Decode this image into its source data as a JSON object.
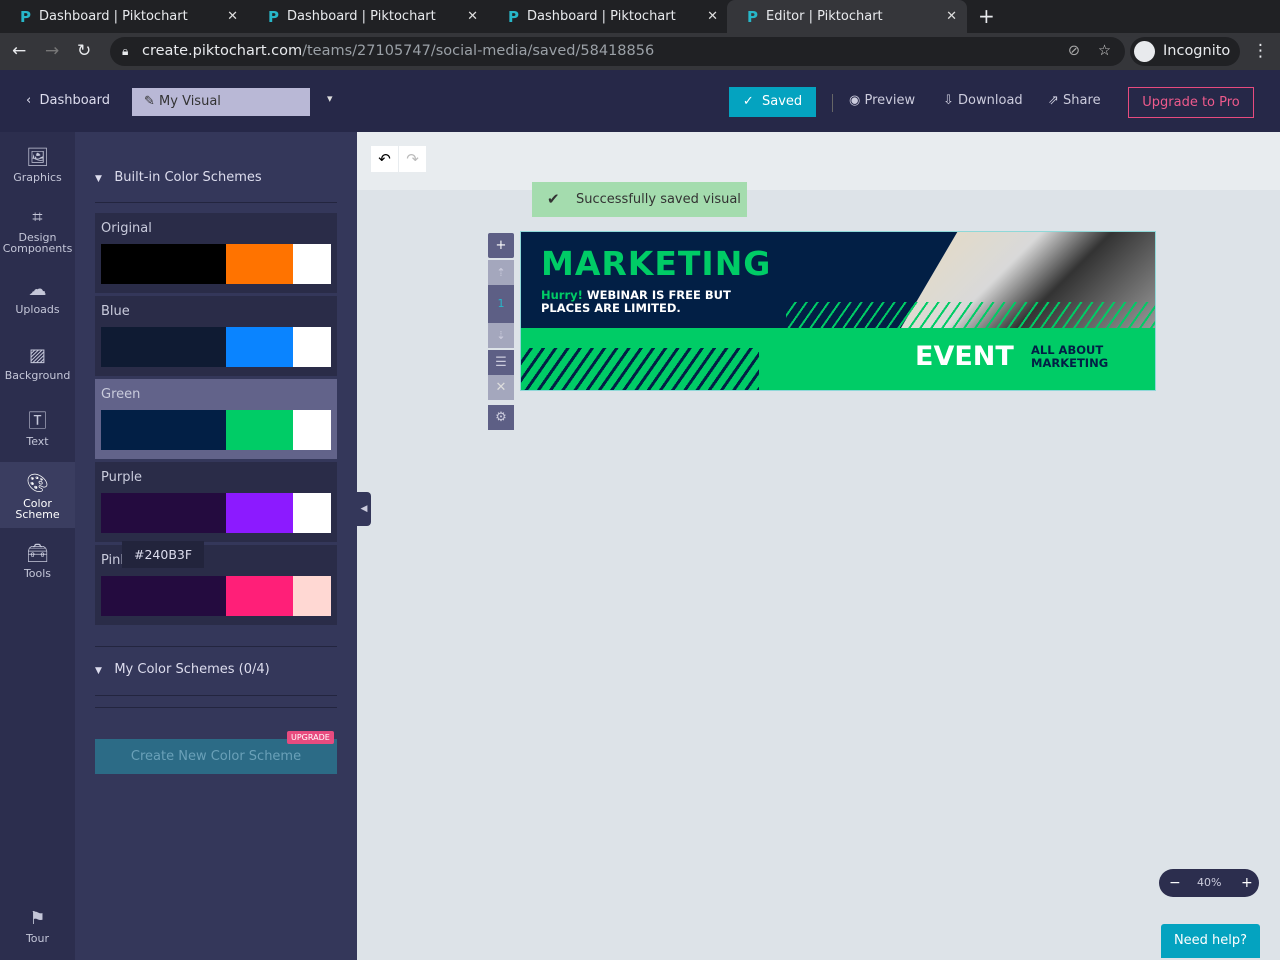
{
  "browser": {
    "tabs": [
      {
        "title": "Dashboard | Piktochart"
      },
      {
        "title": "Dashboard | Piktochart"
      },
      {
        "title": "Dashboard | Piktochart"
      },
      {
        "title": "Editor | Piktochart",
        "active": true
      }
    ],
    "url_host": "create.piktochart.com",
    "url_path": "/teams/27105747/social-media/saved/58418856",
    "profile": "Incognito"
  },
  "header": {
    "back_label": "Dashboard",
    "title_value": "My Visual",
    "saved_label": "Saved",
    "preview_label": "Preview",
    "download_label": "Download",
    "share_label": "Share",
    "upgrade_label": "Upgrade to Pro"
  },
  "rail": [
    {
      "label": "Graphics",
      "icon": "image-icon"
    },
    {
      "label": "Design Components",
      "icon": "components-icon"
    },
    {
      "label": "Uploads",
      "icon": "cloud-upload-icon"
    },
    {
      "label": "Background",
      "icon": "background-icon"
    },
    {
      "label": "Text",
      "icon": "text-icon"
    },
    {
      "label": "Color Scheme",
      "icon": "palette-icon",
      "active": true
    },
    {
      "label": "Tools",
      "icon": "toolbox-icon"
    },
    {
      "label": "Tour",
      "icon": "signpost-icon"
    }
  ],
  "panel": {
    "builtin_title": "Built-in Color Schemes",
    "schemes": [
      {
        "name": "Original",
        "colors": [
          "#000000",
          "#ff7300",
          "#ffffff"
        ]
      },
      {
        "name": "Blue",
        "colors": [
          "#0f1b33",
          "#0a84ff",
          "#ffffff"
        ]
      },
      {
        "name": "Green",
        "colors": [
          "#021f45",
          "#00cc66",
          "#ffffff"
        ],
        "hovered": true
      },
      {
        "name": "Purple",
        "colors": [
          "#240b3f",
          "#8c1aff",
          "#ffffff"
        ]
      },
      {
        "name": "Pink",
        "colors": [
          "#240b3f",
          "#ff1f78",
          "#ffd8d3"
        ]
      }
    ],
    "tooltip": "#240B3F",
    "my_title": "My Color Schemes (0/4)",
    "create_label": "Create New Color Scheme",
    "upgrade_badge": "UPGRADE"
  },
  "canvas": {
    "toast": "Successfully saved visual",
    "page_number": "1",
    "banner": {
      "title": "MARKETING",
      "hurry": "Hurry!",
      "line1": " WEBINAR IS FREE BUT",
      "line2": "PLACES ARE LIMITED.",
      "event": "EVENT",
      "sub1": "ALL ABOUT",
      "sub2": "MARKETING"
    },
    "zoom": "40%",
    "help_label": "Need help?"
  }
}
